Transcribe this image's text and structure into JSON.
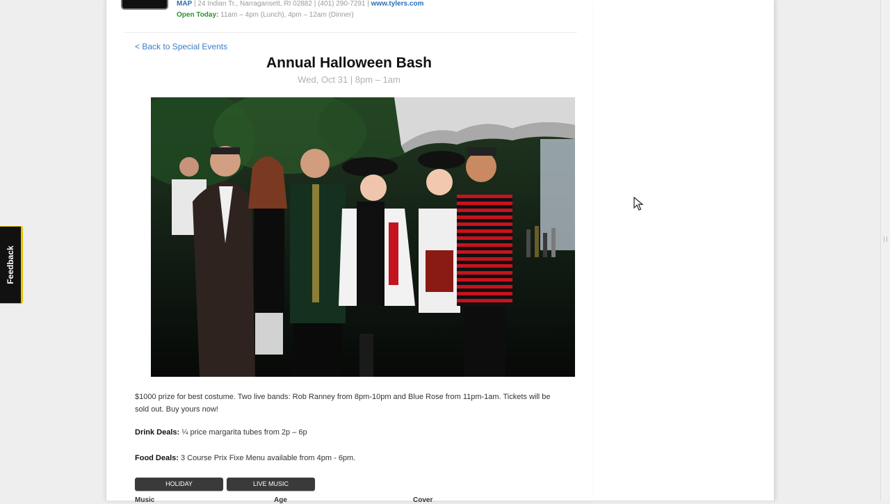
{
  "venue": {
    "map_label": "MAP",
    "address": " | 24 Indian Tr., Narragansett, RI 02882 | (401) 290-7291 | ",
    "website": "www.tylers.com",
    "hours_label": "Open Today:",
    "hours_value": " 11am – 4pm (Lunch), 4pm – 12am (Dinner)"
  },
  "nav": {
    "back_link": "< Back to Special Events"
  },
  "event": {
    "title": "Annual Halloween Bash",
    "date": "Wed, Oct 31 | 8pm – 1am",
    "description": "$1000 prize for best costume. Two live bands: Rob Ranney from 8pm-10pm and Blue Rose from 11pm-1am. Tickets will be sold out. Buy yours now!",
    "drink_label": "Drink Deals:",
    "drink_value": " ¼ price margarita tubes from 2p – 6p",
    "food_label": "Food Deals:",
    "food_value": " 3 Course Prix Fixe Menu available from 4pm - 6pm."
  },
  "tags": [
    "HOLIDAY",
    "LIVE MUSIC"
  ],
  "meta_labels": [
    "Music",
    "Age",
    "Cover"
  ],
  "feedback_tab": "Feedback",
  "icons": {
    "cursor": "mouse-pointer-icon"
  }
}
